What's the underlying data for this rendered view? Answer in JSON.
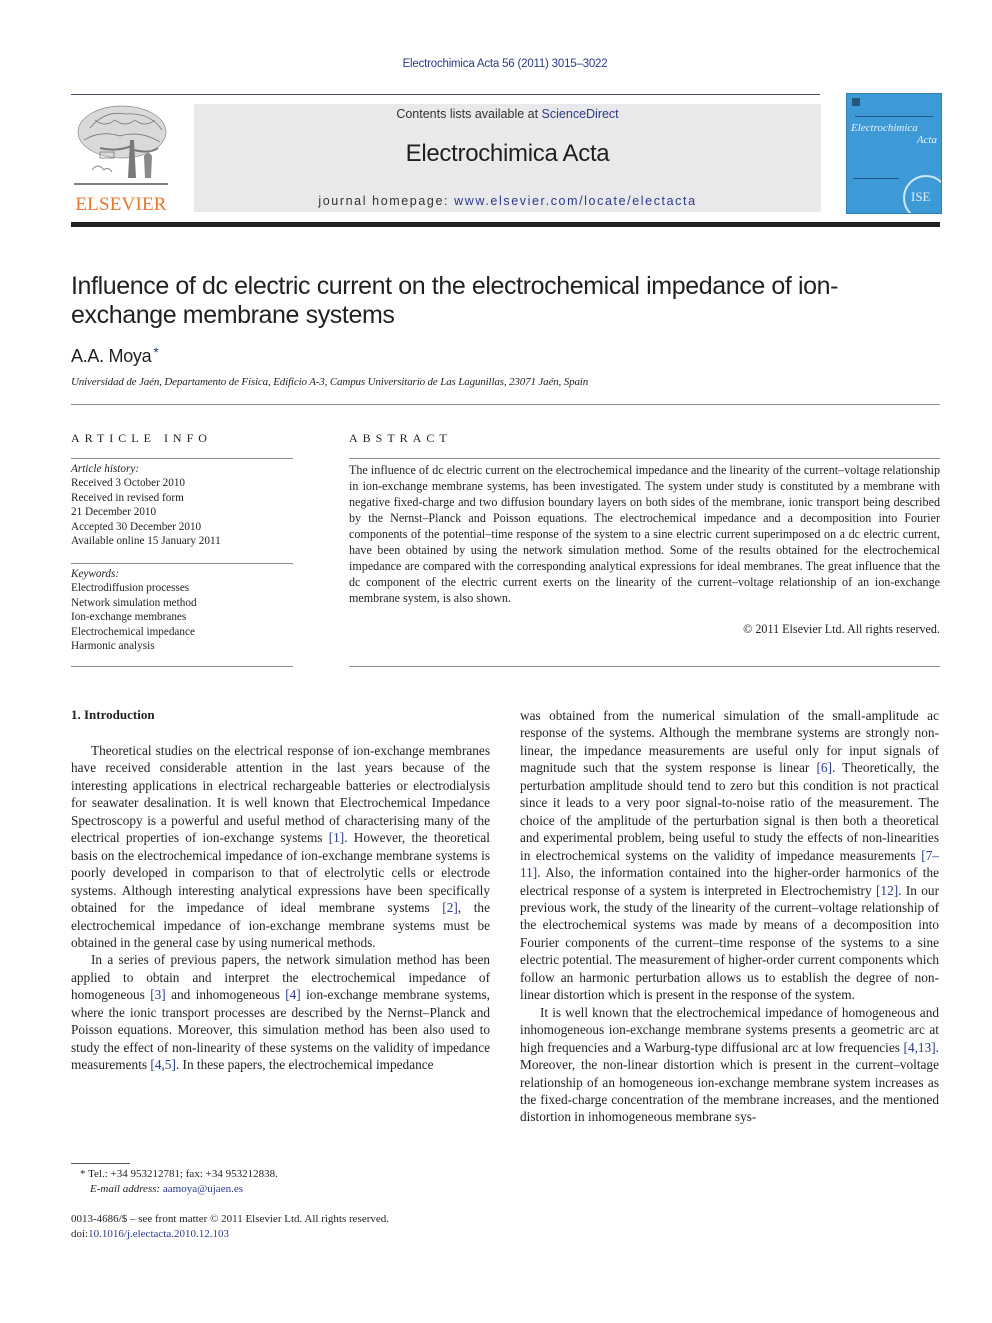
{
  "header": {
    "journal_reference": "Electrochimica Acta 56 (2011) 3015–3022",
    "publisher_logo_text": "ELSEVIER",
    "contents_prefix": "Contents lists available at ",
    "contents_link": "ScienceDirect",
    "journal_title": "Electrochimica Acta",
    "homepage_prefix": "journal homepage: ",
    "homepage_link": "www.elsevier.com/locate/electacta",
    "cover_title_line1": "Electrochimica",
    "cover_title_line2": "Acta",
    "colors": {
      "link": "#2b3a8a",
      "elsevier_orange": "#e8772e",
      "cover_blue": "#3e9ad6",
      "masthead_gray": "#e9e9eb"
    }
  },
  "article": {
    "title": "Influence of dc electric current on the electrochemical impedance of ion-exchange membrane systems",
    "author": "A.A. Moya",
    "author_marker": "*",
    "affiliation": "Universidad de Jaén, Departamento de Física, Edificio A-3, Campus Universitario de Las Lagunillas, 23071 Jaén, Spain"
  },
  "article_info": {
    "label": "ARTICLE INFO",
    "history_label": "Article history:",
    "history": [
      "Received 3 October 2010",
      "Received in revised form",
      "21 December 2010",
      "Accepted 30 December 2010",
      "Available online 15 January 2011"
    ],
    "keywords_label": "Keywords:",
    "keywords": [
      "Electrodiffusion processes",
      "Network simulation method",
      "Ion-exchange membranes",
      "Electrochemical impedance",
      "Harmonic analysis"
    ]
  },
  "abstract": {
    "label": "ABSTRACT",
    "text": "The influence of dc electric current on the electrochemical impedance and the linearity of the current–voltage relationship in ion-exchange membrane systems, has been investigated. The system under study is constituted by a membrane with negative fixed-charge and two diffusion boundary layers on both sides of the membrane, ionic transport being described by the Nernst–Planck and Poisson equations. The electrochemical impedance and a decomposition into Fourier components of the potential–time response of the system to a sine electric current superimposed on a dc electric current, have been obtained by using the network simulation method. Some of the results obtained for the electrochemical impedance are compared with the corresponding analytical expressions for ideal membranes. The great influence that the dc component of the electric current exerts on the linearity of the current–voltage relationship of an ion-exchange membrane system, is also shown.",
    "copyright": "© 2011 Elsevier Ltd. All rights reserved."
  },
  "body": {
    "section_heading": "1.  Introduction",
    "left_p1": [
      "Theoretical studies on the electrical response of ion-exchange membranes have received considerable attention in the last years because of the interesting applications in electrical rechargeable batteries or electrodialysis for seawater desalination. It is well known that Electrochemical Impedance Spectroscopy is a powerful and useful method of characterising many of the electrical properties of ion-exchange systems ",
      "[1]",
      ". However, the theoretical basis on the electrochemical impedance of ion-exchange membrane systems is poorly developed in comparison to that of electrolytic cells or electrode systems. Although interesting analytical expressions have been specifically obtained for the impedance of ideal membrane systems ",
      "[2]",
      ", the electrochemical impedance of ion-exchange membrane systems must be obtained in the general case by using numerical methods."
    ],
    "left_p2": [
      "In a series of previous papers, the network simulation method has been applied to obtain and interpret the electrochemical impedance of homogeneous ",
      "[3]",
      " and inhomogeneous ",
      "[4]",
      " ion-exchange membrane systems, where the ionic transport processes are described by the Nernst–Planck and Poisson equations. Moreover, this simulation method has been also used to study the effect of non-linearity of these systems on the validity of impedance measurements ",
      "[4,5]",
      ". In these papers, the electrochemical impedance"
    ],
    "right_p1": [
      "was obtained from the numerical simulation of the small-amplitude ac response of the systems. Although the membrane systems are strongly non-linear, the impedance measurements are useful only for input signals of magnitude such that the system response is linear ",
      "[6]",
      ". Theoretically, the perturbation amplitude should tend to zero but this condition is not practical since it leads to a very poor signal-to-noise ratio of the measurement. The choice of the amplitude of the perturbation signal is then both a theoretical and experimental problem, being useful to study the effects of non-linearities in electrochemical systems on the validity of impedance measurements ",
      "[7–11]",
      ". Also, the information contained into the higher-order harmonics of the electrical response of a system is interpreted in Electrochemistry ",
      "[12]",
      ". In our previous work, the study of the linearity of the current–voltage relationship of the electrochemical systems was made by means of a decomposition into Fourier components of the current–time response of the systems to a sine electric potential. The measurement of higher-order current components which follow an harmonic perturbation allows us to establish the degree of non-linear distortion which is present in the response of the system."
    ],
    "right_p2": [
      "It is well known that the electrochemical impedance of homogeneous and inhomogeneous ion-exchange membrane systems presents a geometric arc at high frequencies and a Warburg-type diffusional arc at low frequencies ",
      "[4,13]",
      ". Moreover, the non-linear distortion which is present in the current–voltage relationship of an homogeneous ion-exchange membrane system increases as the fixed-charge concentration of the membrane increases, and the mentioned distortion in inhomogeneous membrane sys-"
    ]
  },
  "footnote": {
    "marker": "*",
    "contact": "Tel.: +34 953212781; fax: +34 953212838.",
    "email_label": "E-mail address: ",
    "email": "aamoya@ujaen.es"
  },
  "front_matter": {
    "issn_line": "0013-4686/$ – see front matter © 2011 Elsevier Ltd. All rights reserved.",
    "doi_prefix": "doi:",
    "doi": "10.1016/j.electacta.2010.12.103"
  }
}
